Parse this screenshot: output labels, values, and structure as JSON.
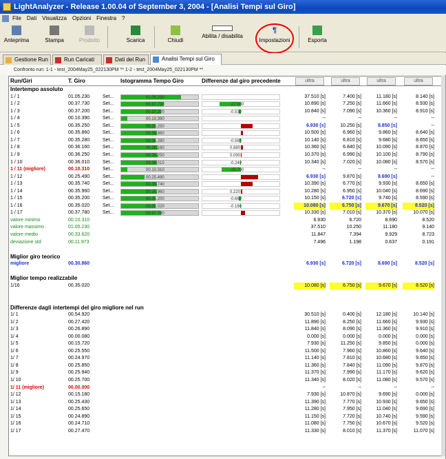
{
  "window": {
    "title": "LightAnalyzer - Release 1.00.04 of September 3, 2004 - [Analisi Tempi sul Giro]"
  },
  "menu": [
    "File",
    "Dati",
    "Visualizza",
    "Opzioni",
    "Finestra",
    "?"
  ],
  "toolbar": {
    "anteprima": "Anteprima",
    "stampa": "Stampa",
    "prodotto": "Prodotto",
    "scarica": "Scarica",
    "chiudi": "Chiudi",
    "abilita": "Abilita / disabilita",
    "impostazioni": "Impostazioni",
    "esporta": "Esporta"
  },
  "tabs": [
    "Gestione Run",
    "Run Caricati",
    "Dati del Run",
    "Analisi Tempi sul Giro"
  ],
  "subtabs": "Confronto run:   1-1 - test_2004May25_022130PM  **  1-2 - test_2004May25_022130PM **",
  "header": {
    "col1": "Run/Giri",
    "col2": "T. Giro",
    "col3": "Istogramma Tempo Giro",
    "col4": "Differenze dal giro precedente",
    "btn": "ultra"
  },
  "section1": "Intertempo assoluto",
  "rows1": [
    {
      "g": "1 / 1",
      "t": "01.05.230",
      "f": 0.78,
      "d": "",
      "dg": 0,
      "dr": 0,
      "a": "37.510 [s]",
      "b": "7.400 [s]",
      "c": "11.180 [s]",
      "e": "8.140 [s]"
    },
    {
      "g": "1 / 2",
      "t": "00.37.730",
      "f": 0.55,
      "d": "-27.500",
      "dg": 0.55,
      "dr": 0,
      "a": "10.890 [s]",
      "b": "7.250 [s]",
      "c": "11.660 [s]",
      "e": "8.930 [s]"
    },
    {
      "g": "1 / 3",
      "t": "00.37.200",
      "f": 0.52,
      "d": "-0.530",
      "dg": 0.06,
      "dr": 0,
      "a": "10.840 [s]",
      "b": "7.090 [s]",
      "c": "10.360 [s]",
      "e": "8.910 [s]"
    },
    {
      "g": "1 / 4",
      "t": "00.10.390",
      "f": 0.08,
      "d": "",
      "dg": 0,
      "dr": 0,
      "a": "--",
      "b": "--",
      "c": "--",
      "e": "--"
    },
    {
      "g": "1 / 5",
      "t": "00.35.250",
      "f": 0.45,
      "d": "",
      "dg": 0,
      "dr": 0.3,
      "a": "6.930 [s]",
      "b": "10.250 [s]",
      "c": "8.850 [s]",
      "e": "--"
    },
    {
      "g": "1 / 6",
      "t": "00.35.860",
      "f": 0.46,
      "d": "",
      "dg": 0,
      "dr": 0.05,
      "a": "10.500 [s]",
      "b": "6.960 [s]",
      "c": "9.860 [s]",
      "e": "8.640 [s]"
    },
    {
      "g": "1 / 7",
      "t": "00.35.280",
      "f": 0.45,
      "d": "-0.580",
      "dg": 0.04,
      "dr": 0,
      "a": "10.140 [s]",
      "b": "6.810 [s]",
      "c": "9.680 [s]",
      "e": "8.650 [s]"
    },
    {
      "g": "1 / 8",
      "t": "00.36.160",
      "f": 0.47,
      "d": "0.880",
      "dg": 0,
      "dr": 0.05,
      "a": "10.360 [s]",
      "b": "6.840 [s]",
      "c": "10.090 [s]",
      "e": "8.870 [s]"
    },
    {
      "g": "1 / 9",
      "t": "00.36.250",
      "f": 0.47,
      "d": "0.090",
      "dg": 0,
      "dr": 0.02,
      "a": "10.370 [s]",
      "b": "6.990 [s]",
      "c": "10.100 [s]",
      "e": "8.790 [s]"
    },
    {
      "g": "1 / 10",
      "t": "00.36.010",
      "f": 0.46,
      "d": "-0.240",
      "dg": 0.02,
      "dr": 0,
      "a": "10.340 [s]",
      "b": "7.020 [s]",
      "c": "10.080 [s]",
      "e": "8.570 [s]"
    },
    {
      "g": "1 / 11 (migliore)",
      "t": "00.10.310",
      "f": 0.08,
      "d": "-25.700",
      "dg": 0.5,
      "dr": 0,
      "a": "--",
      "b": "--",
      "c": "--",
      "e": "--",
      "best": true
    },
    {
      "g": "1 / 12",
      "t": "00.25.490",
      "f": 0.3,
      "d": "",
      "dg": 0,
      "dr": 0.45,
      "a": "6.930 [s]",
      "b": "9.870 [s]",
      "c": "8.690 [s]",
      "e": "--"
    },
    {
      "g": "1 / 13",
      "t": "00.35.740",
      "f": 0.46,
      "d": "",
      "dg": 0,
      "dr": 0.3,
      "a": "10.390 [s]",
      "b": "6.770 [s]",
      "c": "9.930 [s]",
      "e": "8.650 [s]"
    },
    {
      "g": "1 / 14",
      "t": "00.35.960",
      "f": 0.46,
      "d": "0.220",
      "dg": 0,
      "dr": 0.03,
      "a": "10.280 [s]",
      "b": "6.950 [s]",
      "c": "10.040 [s]",
      "e": "8.690 [s]"
    },
    {
      "g": "1 / 15",
      "t": "00.35.200",
      "f": 0.45,
      "d": "-0.660",
      "dg": 0.05,
      "dr": 0,
      "a": "10.150 [s]",
      "b": "6.720 [s]",
      "c": "9.740 [s]",
      "e": "8.590 [s]"
    },
    {
      "g": "1 / 16",
      "t": "00.35.020",
      "f": 0.45,
      "d": "-0.180",
      "dg": 0.02,
      "dr": 0,
      "a": "10.080 [s]",
      "b": "6.750 [s]",
      "c": "9.670 [s]",
      "e": "8.520 [s]",
      "yl": true
    },
    {
      "g": "1 / 17",
      "t": "00.37.780",
      "f": 0.52,
      "d": "",
      "dg": 0,
      "dr": 0.1,
      "a": "10.330 [s]",
      "b": "7.010 [s]",
      "c": "10.370 [s]",
      "e": "10.070 [s]"
    }
  ],
  "stats": [
    {
      "l": "valore minimo",
      "t": "00.10.310",
      "a": "6.930",
      "b": "6.720",
      "c": "8.690",
      "e": "8.520"
    },
    {
      "l": "valore massimo",
      "t": "01.05.230",
      "a": "37.510",
      "b": "10.250",
      "c": "11.180",
      "e": "9.140"
    },
    {
      "l": "valore medio",
      "t": "00.33.620",
      "a": "11.847",
      "b": "7.394",
      "c": "9.929",
      "e": "8.723"
    },
    {
      "l": "deviazione std",
      "t": "00.11.973",
      "a": "7.496",
      "b": "1.198",
      "c": "0.637",
      "e": "0.191"
    }
  ],
  "section2": "Miglior giro teorico",
  "migliore": {
    "l": "migliore",
    "t": "00.30.860",
    "a": "6.930 [s]",
    "b": "6.720 [s]",
    "c": "8.690 [s]",
    "e": "8.520 [s]"
  },
  "section3": "Miglior tempo realizzabile",
  "realiz": {
    "l": "1/16",
    "t": "00.35.020",
    "a": "10.080 [s]",
    "b": "6.750 [s]",
    "c": "9.670 [s]",
    "e": "8.520 [s]"
  },
  "section4": "Differenze dagli intertempi del giro migliore nel run",
  "rows2": [
    {
      "g": "1/ 1",
      "t": "00.54.920",
      "a": "30.510 [s]",
      "b": "0.400 [s]",
      "c": "12.180 [s]",
      "e": "10.140 [s]"
    },
    {
      "g": "1/ 2",
      "t": "00.27.420",
      "a": "11.890 [s]",
      "b": "8.250 [s]",
      "c": "11.660 [s]",
      "e": "9.930 [s]"
    },
    {
      "g": "1/ 3",
      "t": "00.26.890",
      "a": "11.840 [s]",
      "b": "8.090 [s]",
      "c": "11.360 [s]",
      "e": "9.910 [s]"
    },
    {
      "g": "1/ 4",
      "t": "00.00.080",
      "a": "0.000 [s]",
      "b": "0.000 [s]",
      "c": "0.000 [s]",
      "e": "0.000 [s]"
    },
    {
      "g": "1/ 5",
      "t": "00.15.720",
      "a": "7.930 [s]",
      "b": "11.250 [s]",
      "c": "9.850 [s]",
      "e": "0.000 [s]"
    },
    {
      "g": "1/ 6",
      "t": "00.25.550",
      "a": "11.500 [s]",
      "b": "7.960 [s]",
      "c": "10.860 [s]",
      "e": "9.640 [s]"
    },
    {
      "g": "1/ 7",
      "t": "00.24.970",
      "a": "11.140 [s]",
      "b": "7.810 [s]",
      "c": "10.680 [s]",
      "e": "9.650 [s]"
    },
    {
      "g": "1/ 8",
      "t": "00.25.850",
      "a": "11.360 [s]",
      "b": "7.840 [s]",
      "c": "11.090 [s]",
      "e": "9.870 [s]"
    },
    {
      "g": "1/ 9",
      "t": "00.25.940",
      "a": "11.370 [s]",
      "b": "7.990 [s]",
      "c": "11.170 [s]",
      "e": "9.620 [s]"
    },
    {
      "g": "1/ 10",
      "t": "00.25.700",
      "a": "11.340 [s]",
      "b": "8.020 [s]",
      "c": "11.080 [s]",
      "e": "9.570 [s]"
    },
    {
      "g": "1/ 11 (migliore)",
      "t": "00.00.000",
      "a": "--",
      "b": "--",
      "c": "--",
      "e": "--",
      "best": true
    },
    {
      "g": "1/ 12",
      "t": "00.15.180",
      "a": "7.930 [s]",
      "b": "10.870 [s]",
      "c": "9.690 [s]",
      "e": "0.000 [s]"
    },
    {
      "g": "1/ 13",
      "t": "00.25.430",
      "a": "11.390 [s]",
      "b": "7.770 [s]",
      "c": "10.930 [s]",
      "e": "9.650 [s]"
    },
    {
      "g": "1/ 14",
      "t": "00.25.650",
      "a": "11.280 [s]",
      "b": "7.950 [s]",
      "c": "11.040 [s]",
      "e": "9.690 [s]"
    },
    {
      "g": "1/ 15",
      "t": "00.24.890",
      "a": "11.150 [s]",
      "b": "7.720 [s]",
      "c": "10.740 [s]",
      "e": "9.590 [s]"
    },
    {
      "g": "1/ 16",
      "t": "00.24.710",
      "a": "11.080 [s]",
      "b": "7.750 [s]",
      "c": "10.670 [s]",
      "e": "9.520 [s]"
    },
    {
      "g": "1/ 17",
      "t": "00.27.470",
      "a": "11.330 [s]",
      "b": "8.010 [s]",
      "c": "11.370 [s]",
      "e": "11.070 [s]"
    }
  ],
  "set": "Set..."
}
